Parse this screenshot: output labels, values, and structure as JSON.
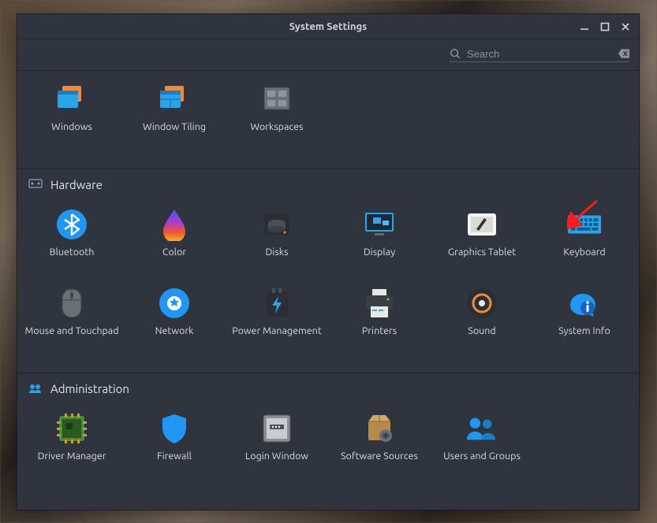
{
  "window": {
    "title": "System Settings"
  },
  "search": {
    "placeholder": "Search"
  },
  "sections": {
    "prefs": {
      "items": [
        "Windows",
        "Window Tiling",
        "Workspaces"
      ]
    },
    "hardware": {
      "title": "Hardware",
      "items": [
        "Bluetooth",
        "Color",
        "Disks",
        "Display",
        "Graphics Tablet",
        "Keyboard",
        "Mouse and Touchpad",
        "Network",
        "Power Management",
        "Printers",
        "Sound",
        "System Info"
      ]
    },
    "administration": {
      "title": "Administration",
      "items": [
        "Driver Manager",
        "Firewall",
        "Login Window",
        "Software Sources",
        "Users and Groups"
      ]
    }
  },
  "annotation": {
    "arrow_target": "keyboard"
  }
}
